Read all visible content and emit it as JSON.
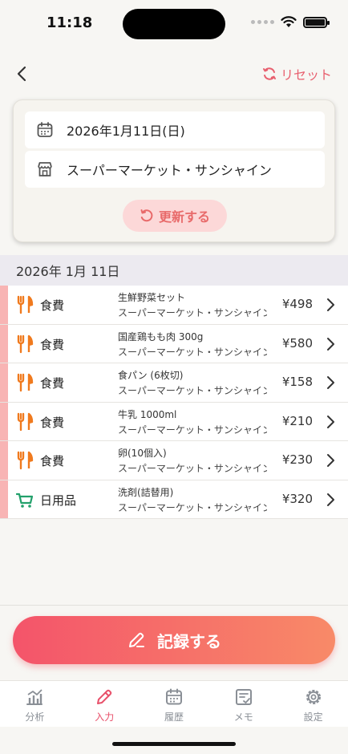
{
  "status": {
    "time": "11:18"
  },
  "nav": {
    "reset_label": "リセット"
  },
  "form": {
    "date": "2026年1月11日(日)",
    "store": "スーパーマーケット・サンシャイン",
    "update_label": "更新する"
  },
  "section": {
    "date_header": "2026年 1月 11日"
  },
  "items": [
    {
      "category": "食費",
      "icon": "fork-knife-icon",
      "name": "生鮮野菜セット",
      "store": "スーパーマーケット・サンシャイン",
      "price": "¥498"
    },
    {
      "category": "食費",
      "icon": "fork-knife-icon",
      "name": "国産鶏もも肉 300g",
      "store": "スーパーマーケット・サンシャイン",
      "price": "¥580"
    },
    {
      "category": "食費",
      "icon": "fork-knife-icon",
      "name": "食パン (6枚切)",
      "store": "スーパーマーケット・サンシャイン",
      "price": "¥158"
    },
    {
      "category": "食費",
      "icon": "fork-knife-icon",
      "name": "牛乳 1000ml",
      "store": "スーパーマーケット・サンシャイン",
      "price": "¥210"
    },
    {
      "category": "食費",
      "icon": "fork-knife-icon",
      "name": "卵(10個入)",
      "store": "スーパーマーケット・サンシャイン",
      "price": "¥230"
    },
    {
      "category": "日用品",
      "icon": "cart-icon",
      "name": "洗剤(詰替用)",
      "store": "スーパーマーケット・サンシャイン",
      "price": "¥320"
    }
  ],
  "actions": {
    "record_label": "記録する"
  },
  "tabs": [
    {
      "label": "分析",
      "icon": "chart-icon"
    },
    {
      "label": "入力",
      "icon": "pencil-icon"
    },
    {
      "label": "履歴",
      "icon": "calendar-icon"
    },
    {
      "label": "メモ",
      "icon": "memo-icon"
    },
    {
      "label": "設定",
      "icon": "gear-icon"
    }
  ],
  "colors": {
    "accent": "#e8506a",
    "food_icon": "#f07a1e",
    "daily_icon": "#22a06b",
    "row_bar": "#f8b4b4"
  }
}
